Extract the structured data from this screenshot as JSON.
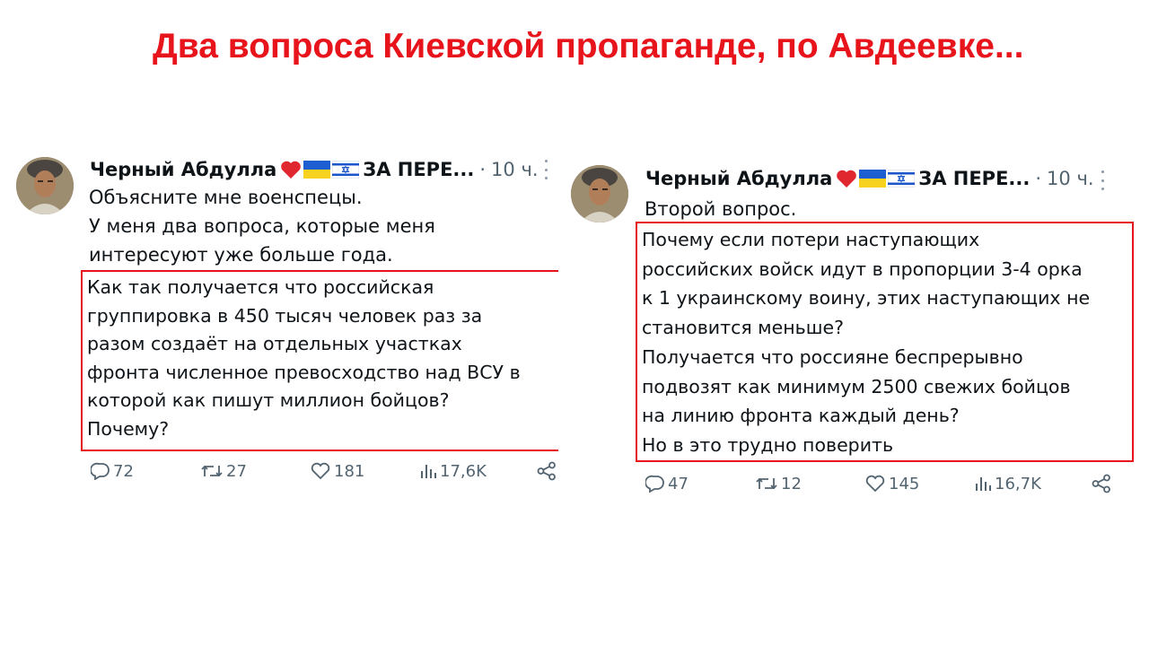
{
  "headline": "Два вопроса Киевской пропаганде, по Авдеевке...",
  "tweets": [
    {
      "author": "Черный Абдулла",
      "badges": [
        "heart-emoji",
        "ukraine-flag",
        "israel-flag"
      ],
      "handle": "ЗА ПЕРЕ...",
      "dot": "·",
      "time": "10 ч.",
      "intro": [
        "Объясните мне военспецы.",
        "У меня два вопроса, которые меня",
        "интересуют уже больше года."
      ],
      "highlight": [
        "Как так получается что российская",
        "группировка в 450 тысяч человек раз за",
        "разом создаёт на отдельных участках",
        "фронта численное превосходство над ВСУ в",
        "которой как пишут миллион бойцов?",
        "Почему?"
      ],
      "stats": {
        "replies": "72",
        "reposts": "27",
        "likes": "181",
        "views": "17,6K"
      }
    },
    {
      "author": "Черный Абдулла",
      "badges": [
        "heart-emoji",
        "ukraine-flag",
        "israel-flag"
      ],
      "handle": "ЗА ПЕРЕ...",
      "dot": "·",
      "time": "10 ч.",
      "intro": [
        "Второй вопрос."
      ],
      "highlight": [
        "Почему если потери наступающих",
        "российских войск идут в пропорции 3-4 орка",
        "к 1 украинскому воину, этих наступающих не",
        "становится меньше?",
        "Получается что россияне беспрерывно",
        "подвозят как минимум 2500 свежих бойцов",
        "на линию фронта каждый день?",
        "Но в это трудно поверить"
      ],
      "stats": {
        "replies": "47",
        "reposts": "12",
        "likes": "145",
        "views": "16,7K"
      }
    }
  ],
  "colors": {
    "headline": "#e8141c",
    "highlight_border": "#e8141c",
    "muted": "#536471",
    "text": "#0f1419"
  }
}
